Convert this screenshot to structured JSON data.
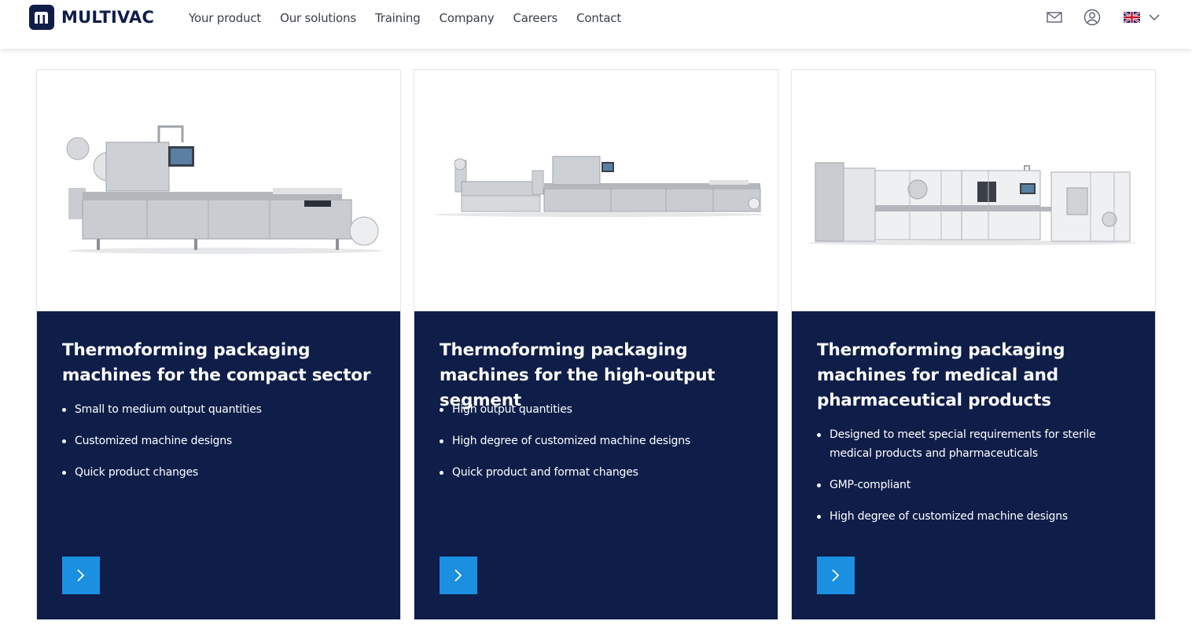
{
  "header": {
    "brand": "MULTIVAC",
    "nav": [
      "Your product",
      "Our solutions",
      "Training",
      "Company",
      "Careers",
      "Contact"
    ],
    "icons": [
      "mail-icon",
      "user-icon",
      "uk-flag-icon",
      "chevron-down-icon"
    ]
  },
  "cards": [
    {
      "title": "Thermoforming packaging machines for the compact sector",
      "bullets": [
        "Small to medium output quantities",
        "Customized machine designs",
        "Quick product changes"
      ]
    },
    {
      "title": "Thermoforming packaging machines for the high-output segment",
      "bullets": [
        "High output quantities",
        "High degree of customized machine designs",
        "Quick product and format changes"
      ]
    },
    {
      "title": "Thermoforming packaging machines for medical and pharmaceutical products",
      "bullets": [
        "Designed to meet special requirements for sterile medical products and pharmaceuticals",
        "GMP-compliant",
        "High degree of customized machine designs"
      ]
    }
  ],
  "colors": {
    "navy": "#0f1d49",
    "accent": "#1b8fe0",
    "machine": "#c9ccd0"
  }
}
